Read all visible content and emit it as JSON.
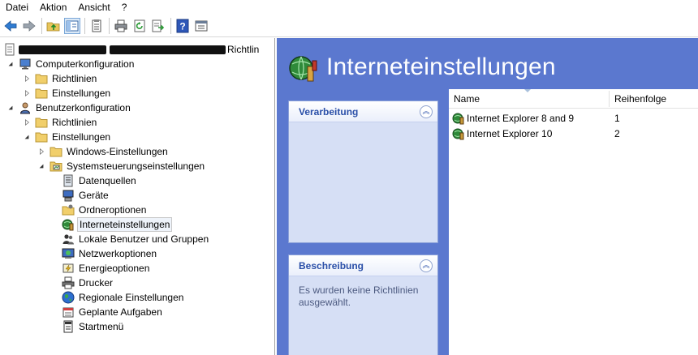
{
  "menu": [
    "Datei",
    "Aktion",
    "Ansicht",
    "?"
  ],
  "toolbar": {
    "icons": [
      "back-icon",
      "forward-icon",
      "up-folder-icon",
      "show-hide-tree-icon",
      "properties-icon",
      "print-icon",
      "refresh-icon",
      "export-list-icon",
      "help-icon",
      "show-console-icon"
    ]
  },
  "tree": {
    "root_label_suffix": "Richtlin",
    "items": [
      {
        "label": "Computerkonfiguration"
      },
      {
        "label": "Richtlinien"
      },
      {
        "label": "Einstellungen"
      },
      {
        "label": "Benutzerkonfiguration"
      },
      {
        "label": "Richtlinien"
      },
      {
        "label": "Einstellungen"
      },
      {
        "label": "Windows-Einstellungen"
      },
      {
        "label": "Systemsteuerungseinstellungen"
      },
      {
        "label": "Datenquellen"
      },
      {
        "label": "Geräte"
      },
      {
        "label": "Ordneroptionen"
      },
      {
        "label": "Interneteinstellungen"
      },
      {
        "label": "Lokale Benutzer und Gruppen"
      },
      {
        "label": "Netzwerkoptionen"
      },
      {
        "label": "Energieoptionen"
      },
      {
        "label": "Drucker"
      },
      {
        "label": "Regionale Einstellungen"
      },
      {
        "label": "Geplante Aufgaben"
      },
      {
        "label": "Startmenü"
      }
    ]
  },
  "details": {
    "title": "Interneteinstellungen",
    "processing_panel": {
      "title": "Verarbeitung"
    },
    "description_panel": {
      "title": "Beschreibung",
      "text": "Es wurden keine Richtlinien ausgewählt."
    },
    "columns": {
      "name": "Name",
      "order": "Reihenfolge"
    },
    "rows": [
      {
        "name": "Internet Explorer 8 and 9",
        "order": "1"
      },
      {
        "name": "Internet Explorer 10",
        "order": "2"
      }
    ]
  },
  "colors": {
    "accent": "#5b78cf",
    "panel": "#d6dff5",
    "panel_title": "#2a4fa8"
  }
}
